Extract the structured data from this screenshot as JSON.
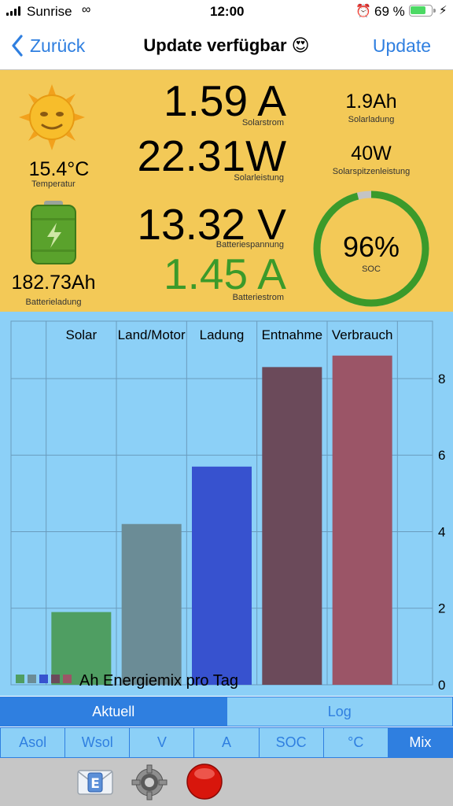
{
  "status": {
    "carrier": "Sunrise",
    "time": "12:00",
    "battery_pct": "69 %"
  },
  "nav": {
    "back_label": "Zurück",
    "title": "Update verfügbar 😍",
    "action_label": "Update"
  },
  "info": {
    "temperature": {
      "value": "15.4°C",
      "label": "Temperatur"
    },
    "battery_charge": {
      "value": "182.73Ah",
      "label": "Batterieladung"
    },
    "solar_current": {
      "value": "1.59 A",
      "label": "Solarstrom"
    },
    "solar_power": {
      "value": "22.31W",
      "label": "Solarleistung"
    },
    "battery_voltage": {
      "value": "13.32 V",
      "label": "Batteriespannung"
    },
    "battery_current": {
      "value": "1.45 A",
      "label": "Batteriestrom"
    },
    "solar_charge": {
      "value": "1.9Ah",
      "label": "Solarladung"
    },
    "solar_peak": {
      "value": "40W",
      "label": "Solarspitzenleistung"
    },
    "soc": {
      "value": "96%",
      "label": "SOC",
      "fraction": 0.96
    },
    "colors": {
      "accent_green": "#3b9a2a",
      "panel": "#f3c957"
    }
  },
  "chart_data": {
    "type": "bar",
    "categories": [
      "Solar",
      "Land/Motor",
      "Ladung",
      "Entnahme",
      "Verbrauch"
    ],
    "values": [
      1.9,
      4.2,
      5.7,
      8.3,
      8.6
    ],
    "colors": [
      "#4f9e62",
      "#6b8c96",
      "#3752cf",
      "#6b4a5a",
      "#9b5567"
    ],
    "ylim": [
      0,
      9.5
    ],
    "yticks": [
      "0",
      "2",
      "4",
      "6",
      "8"
    ],
    "ytick_values": [
      0,
      2,
      4,
      6,
      8
    ],
    "legend": "Ah Energiemix pro Tag",
    "grid": true
  },
  "tabs": {
    "items": [
      "Aktuell",
      "Log"
    ],
    "selected": 0
  },
  "modes": {
    "items": [
      "Asol",
      "Wsol",
      "V",
      "A",
      "SOC",
      "°C",
      "Mix"
    ],
    "selected": 6
  },
  "toolbar": {
    "icons": [
      "mail-icon",
      "settings-gear-icon",
      "record-stop-icon"
    ]
  }
}
